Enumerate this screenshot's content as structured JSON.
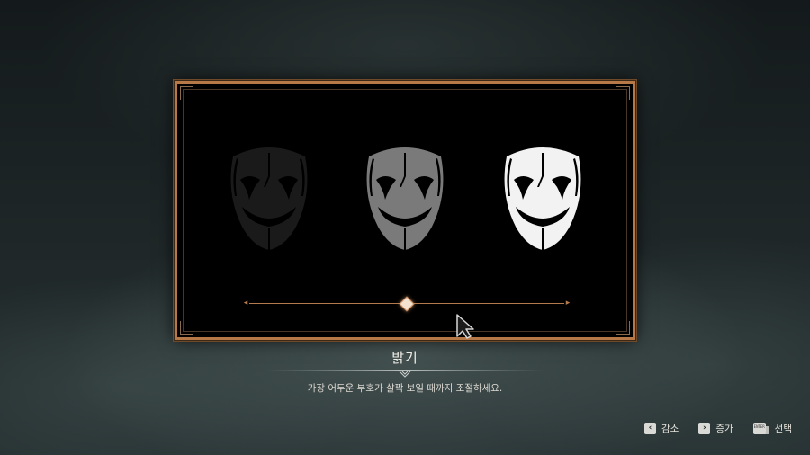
{
  "screen": {
    "title": "밝기",
    "description": "가장 어두운 부호가 살짝 보일 때까지 조절하세요."
  },
  "masks": [
    {
      "name": "dark",
      "color": "#1a1a1a"
    },
    {
      "name": "mid",
      "color": "#7a7a7a"
    },
    {
      "name": "light",
      "color": "#f2f2f2"
    }
  ],
  "slider": {
    "value_fraction": 0.5,
    "track_color": "#b57a4c",
    "handle_color": "#f2e2cf"
  },
  "prompts": [
    {
      "key_icon": "left-arrow-key-icon",
      "key_glyph": "‹",
      "label": "감소"
    },
    {
      "key_icon": "right-arrow-key-icon",
      "key_glyph": "›",
      "label": "증가"
    },
    {
      "key_icon": "enter-key-icon",
      "key_glyph": "ENTER",
      "label": "선택"
    }
  ],
  "colors": {
    "frame_border": "#b67846",
    "accent": "#b57a4c"
  }
}
